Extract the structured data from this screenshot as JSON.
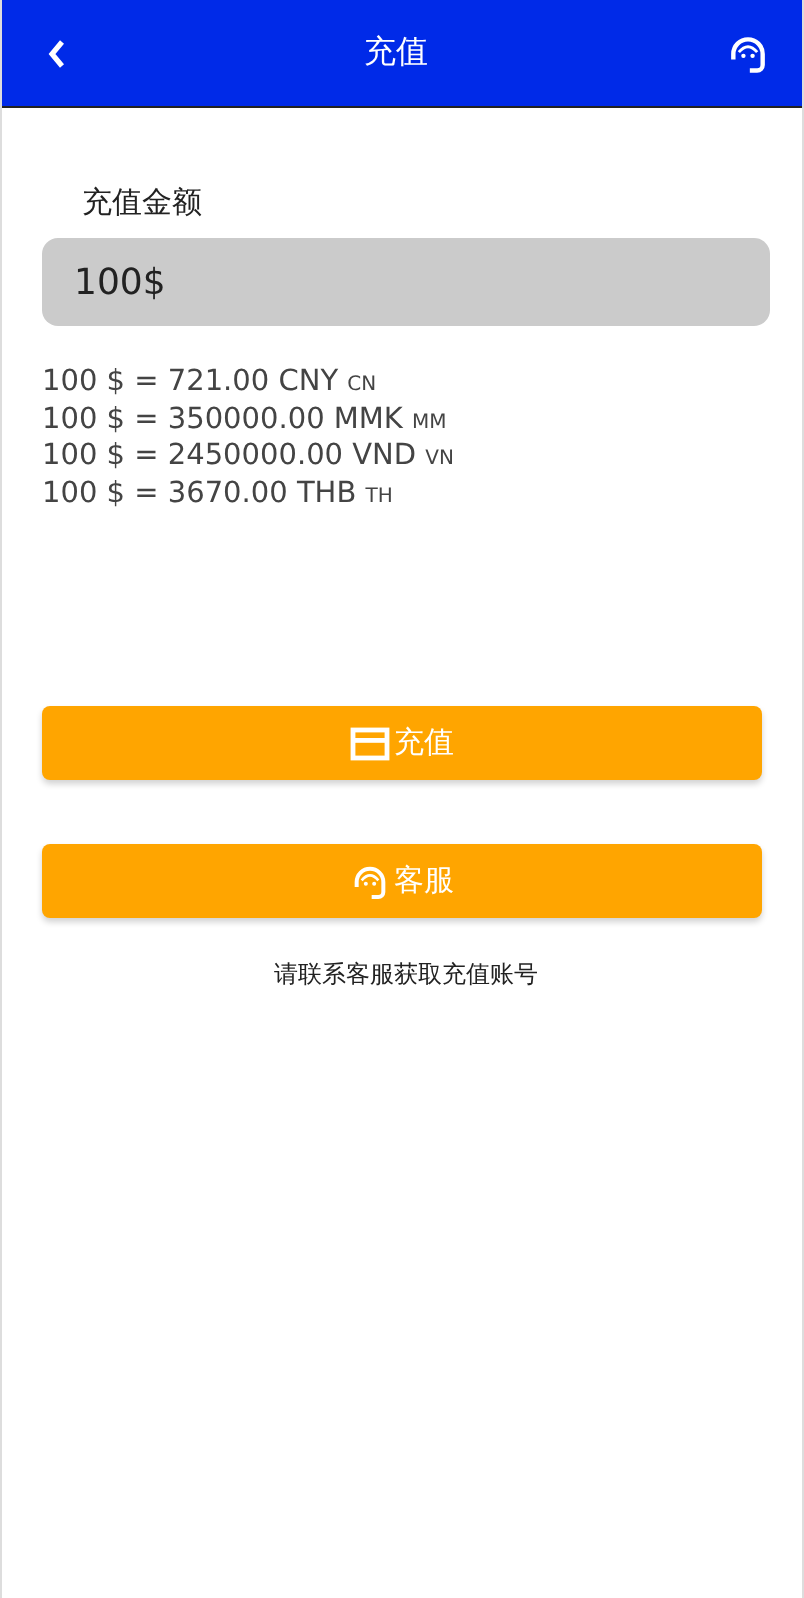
{
  "header": {
    "title": "充值"
  },
  "amount": {
    "label": "充值金额",
    "value": "100$"
  },
  "rates": [
    {
      "text": "100 $ = 721.00 CNY",
      "code": "CN"
    },
    {
      "text": "100 $ = 350000.00 MMK",
      "code": "MM"
    },
    {
      "text": "100 $ = 2450000.00 VND",
      "code": "VN"
    },
    {
      "text": "100 $ = 3670.00 THB",
      "code": "TH"
    }
  ],
  "buttons": [
    {
      "kind": "card",
      "label": "充值"
    },
    {
      "kind": "headset",
      "label": "客服"
    }
  ],
  "note": "请联系客服获取充值账号"
}
